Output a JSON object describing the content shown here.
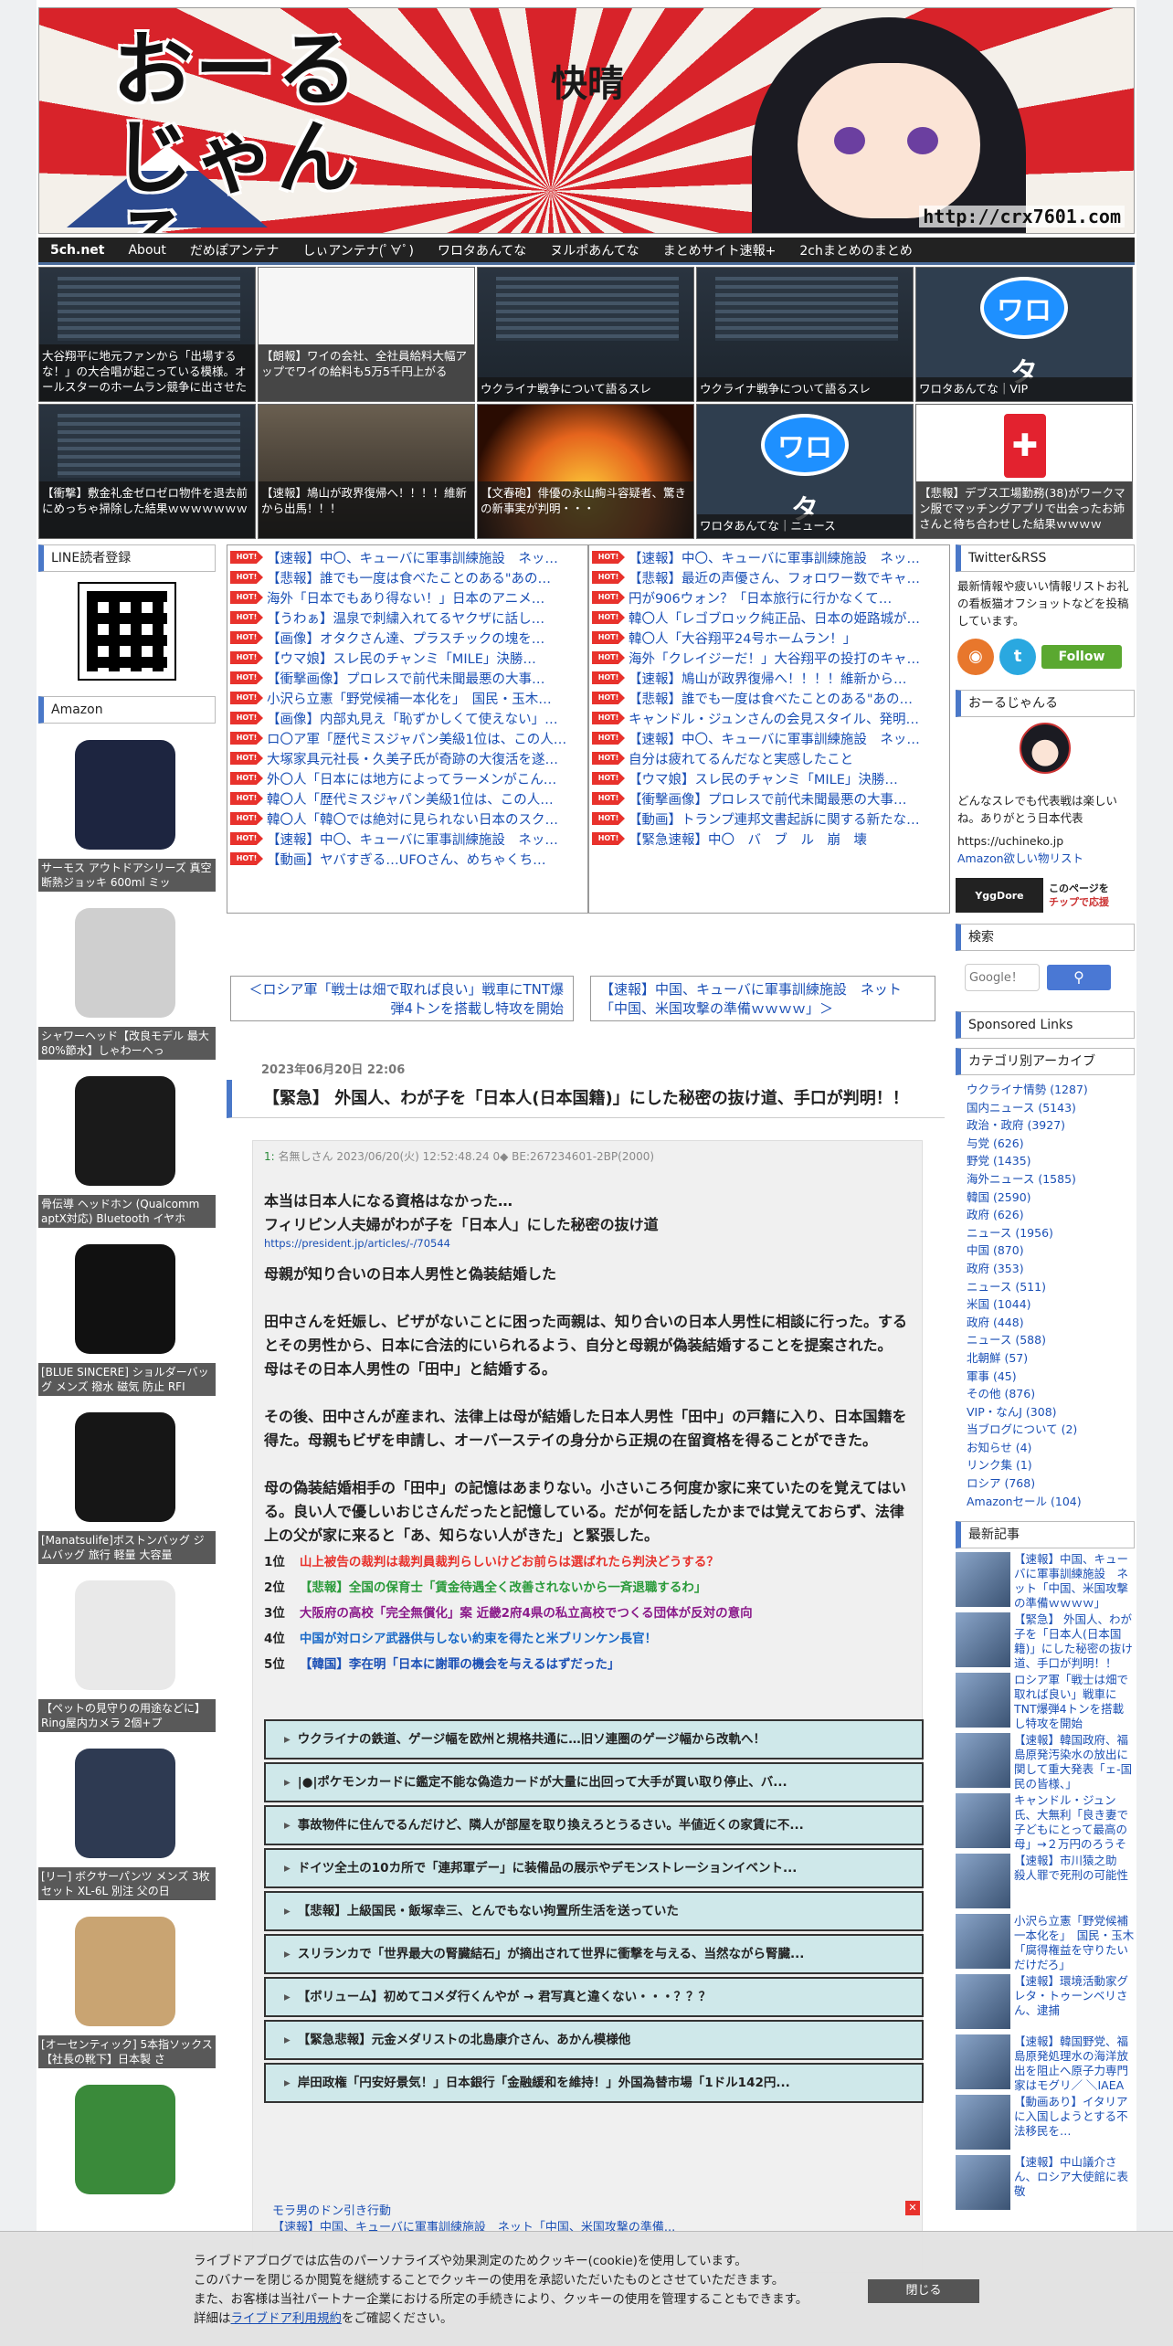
{
  "header": {
    "logo": "おーるじゃんる",
    "url": "http://crx7601.com",
    "kanji": "快晴"
  },
  "nav": [
    "5ch.net",
    "About",
    "だめぽアンテナ",
    "しぃアンテナ(ﾟ∀ﾟ)",
    "ワロタあんてな",
    "ヌルポあんてな",
    "まとめサイト速報+",
    "2chまとめのまとめ"
  ],
  "grid": [
    {
      "thumb": "dark",
      "caption": "大谷翔平に地元ファンから「出場するな！」の大合唱が起こっている模様。オールスターのホームラン競争に出させた"
    },
    {
      "thumb": "white",
      "caption": "【朗報】ワイの会社、全社員給料大幅アップでワイの給料も5万5千円上がる"
    },
    {
      "thumb": "dark",
      "caption": "ウクライナ戦争について語るスレ"
    },
    {
      "thumb": "dark",
      "caption": "ウクライナ戦争について語るスレ"
    },
    {
      "thumb": "wrota",
      "caption": "ワロタあんてな｜VIP",
      "badge": "ワロタ"
    },
    {
      "thumb": "dark",
      "caption": "【衝撃】敷金礼金ゼロゼロ物件を退去前にめっちゃ掃除した結果ｗｗｗｗｗｗｗ"
    },
    {
      "thumb": "people",
      "caption": "【速報】鳩山が政界復帰へ！！！！維新から出馬！！！"
    },
    {
      "thumb": "fire",
      "caption": "【文春砲】俳優の永山絢斗容疑者、驚きの新事実が判明・・・"
    },
    {
      "thumb": "wrota",
      "caption": "ワロタあんてな｜ニュース",
      "badge": "ワロタ"
    },
    {
      "thumb": "cross",
      "caption": "【悲報】デブス工場勤務(38)がワークマン服でマッチングアプリで出会ったお姉さんと待ち合わせした結果ｗｗｗｗ"
    }
  ],
  "left": {
    "line_title": "LINE読者登録",
    "amazon_title": "Amazon",
    "products": [
      {
        "caption": "サーモス アウトドアシリーズ 真空断熱ジョッキ 600ml ミッ",
        "color": "#1d2540"
      },
      {
        "caption": "シャワーヘッド【改良モデル 最大80%節水】しゃわーへっ",
        "color": "#cfcfcf"
      },
      {
        "caption": "骨伝導 ヘッドホン (Qualcomm aptX対応) Bluetooth イヤホ",
        "color": "#1a1a1a"
      },
      {
        "caption": "[BLUE SINCERE] ショルダーバッグ メンズ 撥水 磁気 防止 RFI",
        "color": "#111"
      },
      {
        "caption": "[Manatsulife]ボストンバッグ ジムバッグ 旅行 軽量 大容量",
        "color": "#161616"
      },
      {
        "caption": "【ペットの見守りの用途などに】Ring屋内カメラ 2個+プ",
        "color": "#e9e9e9"
      },
      {
        "caption": "[リー] ボクサーパンツ メンズ 3枚セット XL-6L 別注 父の日",
        "color": "#2e3a52"
      },
      {
        "caption": "[オーセンティック] 5本指ソックス 【社長の靴下】日本製 さ",
        "color": "#c9a472"
      },
      {
        "caption": "",
        "color": "#3a8a3a"
      }
    ]
  },
  "rank_left": [
    "【速報】中〇、キューバに軍事訓練施設　ネッ…",
    "【悲報】誰でも一度は食べたことのある\"あの…",
    "海外「日本でもあり得ない！」日本のアニメ…",
    "【うわぁ】温泉で刺繍入れてるヤクザに話し…",
    "【画像】オタクさん達、プラスチックの塊を…",
    "【ウマ娘】スレ民のチャンミ「MILE」決勝…",
    "【衝撃画像】プロレスで前代未聞最悪の大事…",
    "小沢ら立憲「野党候補一本化を」　国民・玉木…",
    "【画像】内部丸見え「恥ずかしくて使えない」…",
    "ロ〇ア軍「歴代ミスジャパン美級1位は、この人…",
    "大塚家具元社長・久美子氏が奇跡の大復活を遂…",
    "外〇人「日本には地方によってラーメンがこん…",
    "韓〇人「歴代ミスジャパン美級1位は、この人…",
    "韓〇人「韓〇では絶対に見られない日本のスク…",
    "【速報】中〇、キューバに軍事訓練施設　ネッ…",
    "【動画】ヤバすぎる…UFOさん、めちゃくち…"
  ],
  "rank_right": [
    "【速報】中〇、キューバに軍事訓練施設　ネッ…",
    "【悲報】最近の声優さん、フォロワー数でキャ…",
    "円が906ウォン？「日本旅行に行かなくて…",
    "韓〇人「レゴブロック純正品、日本の姫路城が…",
    "韓〇人「大谷翔平24号ホームラン！」",
    "海外「クレイジーだ！」大谷翔平の投打のキャ…",
    "【速報】鳩山が政界復帰へ！！！！維新から…",
    "【悲報】誰でも一度は食べたことのある\"あの…",
    "キャンドル・ジュンさんの会見スタイル、発明…",
    "【速報】中〇、キューバに軍事訓練施設　ネッ…",
    "自分は疲れてるんだなと実感したこと",
    "【ウマ娘】スレ民のチャンミ「MILE」決勝…",
    "【衝撃画像】プロレスで前代未聞最悪の大事…",
    "【動画】トランプ連邦文書起訴に関する新たな…",
    "【緊急速報】中〇　バ　ブ　ル　崩　壊"
  ],
  "hot_label": "HOT!",
  "pager": {
    "prev": "＜ロシア軍「戦士は畑で取れば良い」戦車にTNT爆弾4トンを搭載し特攻を開始",
    "next": "【速報】中国、キューバに軍事訓練施設　ネット「中国、米国攻撃の準備ｗｗｗｗ」＞"
  },
  "article": {
    "date": "2023年06月20日 22:06",
    "title": "【緊急】 外国人、わが子を「日本人(日本国籍)」にした秘密の抜け道、手口が判明！！",
    "meta_num": "1:",
    "meta_rest": "名無しさん 2023/06/20(火) 12:52:48.24 0◆ BE:267234601-2BP(2000)",
    "lead1": "本当は日本人になる資格はなかった…",
    "lead2": "フィリピン人夫婦がわが子を「日本人」にした秘密の抜け道",
    "link": "https://president.jp/articles/-/70544",
    "p1": "母親が知り合いの日本人男性と偽装結婚した",
    "p2": "田中さんを妊娠し、ビザがないことに困った両親は、知り合いの日本人男性に相談に行った。するとその男性から、日本に合法的にいられるよう、自分と母親が偽装結婚することを提案された。 母はその日本人男性の「田中」と結婚する。",
    "p3": "その後、田中さんが産まれ、法律上は母が結婚した日本人男性「田中」の戸籍に入り、日本国籍を得た。母親もビザを申請し、オーバーステイの身分から正規の在留資格を得ることができた。",
    "p4": "母の偽装結婚相手の「田中」の記憶はあまりない。小さいころ何度か家に来ていたのを覚えてはいる。良い人で優しいおじさんだったと記憶している。だが何を話したかまでは覚えておらず、法律上の父が家に来ると「あ、知らない人がきた」と緊張した。",
    "ranking": [
      {
        "pos": "1位",
        "text": "山上被告の裁判は裁判員裁判らしいけどお前らは選ばれたら判決どうする？",
        "color": "#e8322c"
      },
      {
        "pos": "2位",
        "text": "【悲報】全国の保育士「賃金待遇全く改善されないから一斉退職するわ」",
        "color": "#2a9a3a"
      },
      {
        "pos": "3位",
        "text": "大阪府の高校「完全無償化」案 近畿2府4県の私立高校でつくる団体が反対の意向",
        "color": "#8a1a8a"
      },
      {
        "pos": "4位",
        "text": "中国が対ロシア武器供与しない約束を得たと米ブリンケン長官！",
        "color": "#1a6ac8"
      },
      {
        "pos": "5位",
        "text": "【韓国】李在明「日本に謝罪の機会を与えるはずだった」",
        "color": "#1a4fb5"
      }
    ],
    "related": [
      "ウクライナの鉄道、ゲージ幅を欧州と規格共通に…旧ソ連圏のゲージ幅から改軌へ！",
      "|●|ポケモンカードに鑑定不能な偽造カードが大量に出回って大手が買い取り停止、バ...",
      "事故物件に住んでるんだけど、隣人が部屋を取り換えろとうるさい。半値近くの家賃に不...",
      "ドイツ全土の10カ所で「連邦軍デー」に装備品の展示やデモンストレーションイベント...",
      "【悲報】上級国民・飯塚幸三、とんでもない拘置所生活を送っていた",
      "スリランカで「世界最大の腎臓結石」が摘出されて世界に衝撃を与える、当然ながら腎臓...",
      "【ボリューム】初めてコメダ行くんやが → 君写真と違くない・・・？？？",
      "【緊急悲報】元金メダリストの北島康介さん、あかん模様他",
      "岸田政権「円安好景気！」日本銀行「金融緩和を維持！」外国為替市場「1ドル142円..."
    ]
  },
  "right": {
    "twitter_title": "Twitter&RSS",
    "twitter_text": "最新情報や疲いい情報リストお礼の看板猫オフショットなどを投稿しています。",
    "follow": "Follow",
    "about_title": "おーるじゃんる",
    "about_text": "どんなスレでも代表戦は楽しいね。ありがとう日本代表",
    "about_url": "https://uchineko.jp",
    "about_link": "Amazon欲しい物リスト",
    "yg_left": "YggDore",
    "yg_right1": "このページを",
    "yg_right2": "チップで応援",
    "search_title": "検索",
    "search_placeholder": "Google！",
    "sponsored_title": "Sponsored Links",
    "cat_title": "カテゴリ別アーカイブ",
    "categories": [
      "ウクライナ情勢 (1287)",
      "国内ニュース (5143)",
      "政治・政府 (3927)",
      "与党 (626)",
      "野党 (1435)",
      "海外ニュース (1585)",
      "韓国 (2590)",
      "政府 (626)",
      "ニュース (1956)",
      "中国 (870)",
      "政府 (353)",
      "ニュース (511)",
      "米国 (1044)",
      "政府 (448)",
      "ニュース (588)",
      "北朝鮮 (57)",
      "軍事 (45)",
      "その他 (876)",
      "VIP・なんJ (308)",
      "当ブログについて (2)",
      "お知らせ (4)",
      "リンク集 (1)",
      "ロシア (768)",
      "Amazonセール (104)"
    ],
    "recent_title": "最新記事",
    "recent": [
      "【速報】中国、キューバに軍事訓練施設　ネット「中国、米国攻撃の準備ｗｗｗｗ」",
      "【緊急】 外国人、わが子を「日本人(日本国籍)」にした秘密の抜け道、手口が判明！！",
      "ロシア軍「戦士は畑で取れば良い」戦車にTNT爆弾4トンを搭載し特攻を開始",
      "【速報】韓国政府、福島原発汚染水の放出に関して重大発表「ェ-国民の皆様、」",
      "キャンドル・ジュン氏、大無利「良き妻で子どもにとって最高の母」→２万円のろうそくがバカ売れｗｗｗ",
      "【速報】市川猿之助　殺人罪で死刑の可能性",
      "小沢ら立憲「野党候補一本化を」　国民・玉木「腐得権益を守りたいだけだろ」",
      "【速報】環境活動家グレタ・トゥーンベリさん、逮捕",
      "【速報】韓国野党、福島原発処理水の海洋放出を阻止へ原子力専門家はモグリ／ ＼IAEAは真理ではない",
      "【動画あり】イタリアに入国しようとする不法移民を…",
      "【速報】中山議介さん、ロシア大使館に表敬"
    ]
  },
  "bottom": {
    "link1": "モラ男のドン引き行動",
    "link2": "【速報】中国、キューバに軍事訓練施設　ネット「中国、米国攻撃の準備..."
  },
  "cookie": {
    "line1": "ライブドアブログでは広告のパーソナライズや効果測定のためクッキー(cookie)を使用しています。",
    "line2": "このバナーを閉じるか閲覧を継続することでクッキーの使用を承認いただいたものとさせていただきます。",
    "line3": "また、お客様は当社パートナー企業における所定の手続きにより、クッキーの使用を管理することもできます。",
    "line4_pre": "詳細は",
    "line4_link": "ライブドア利用規約",
    "line4_post": "をご確認ください。",
    "close": "閉じる"
  }
}
